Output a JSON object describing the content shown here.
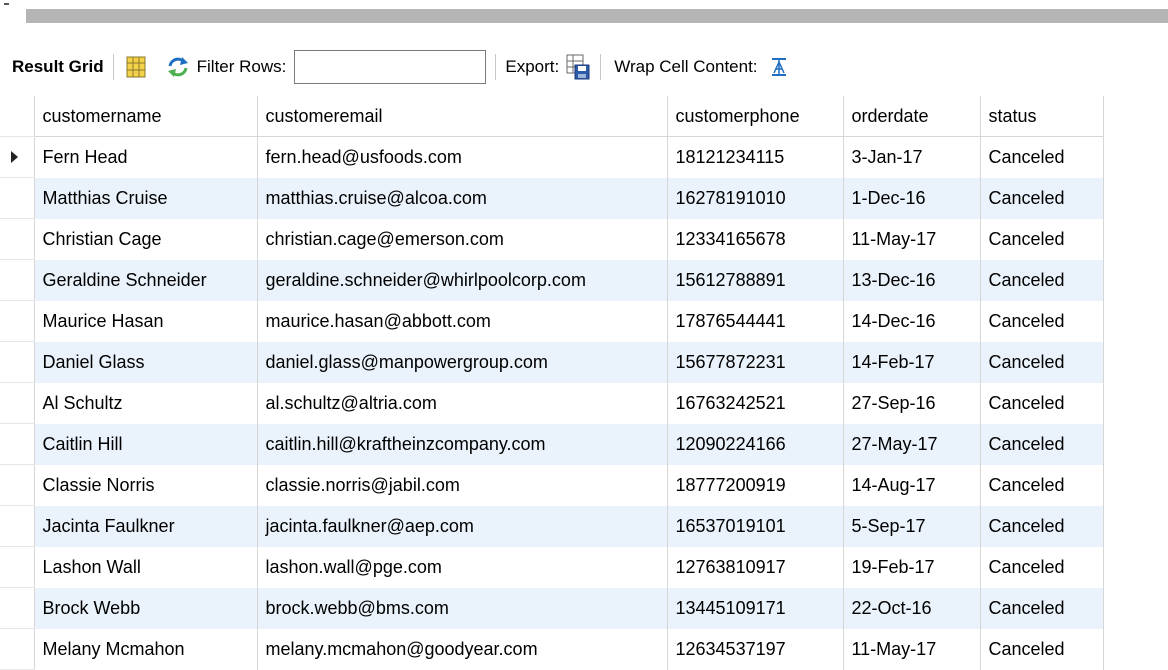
{
  "toolbar": {
    "title": "Result Grid",
    "filter_label": "Filter Rows:",
    "filter_value": "",
    "export_label": "Export:",
    "wrap_label": "Wrap Cell Content:",
    "icons": [
      "grid-toggle-icon",
      "refresh-icon",
      "export-icon",
      "wrap-cell-icon"
    ]
  },
  "grid": {
    "columns": [
      "customername",
      "customeremail",
      "customerphone",
      "orderdate",
      "status"
    ],
    "rows": [
      [
        "Fern Head",
        "fern.head@usfoods.com",
        "18121234115",
        "3-Jan-17",
        "Canceled"
      ],
      [
        "Matthias Cruise",
        "matthias.cruise@alcoa.com",
        "16278191010",
        "1-Dec-16",
        "Canceled"
      ],
      [
        "Christian Cage",
        "christian.cage@emerson.com",
        "12334165678",
        "11-May-17",
        "Canceled"
      ],
      [
        "Geraldine Schneider",
        "geraldine.schneider@whirlpoolcorp.com",
        "15612788891",
        "13-Dec-16",
        "Canceled"
      ],
      [
        "Maurice Hasan",
        "maurice.hasan@abbott.com",
        "17876544441",
        "14-Dec-16",
        "Canceled"
      ],
      [
        "Daniel Glass",
        "daniel.glass@manpowergroup.com",
        "15677872231",
        "14-Feb-17",
        "Canceled"
      ],
      [
        "Al Schultz",
        "al.schultz@altria.com",
        "16763242521",
        "27-Sep-16",
        "Canceled"
      ],
      [
        "Caitlin Hill",
        "caitlin.hill@kraftheinzcompany.com",
        "12090224166",
        "27-May-17",
        "Canceled"
      ],
      [
        "Classie Norris",
        "classie.norris@jabil.com",
        "18777200919",
        "14-Aug-17",
        "Canceled"
      ],
      [
        "Jacinta Faulkner",
        "jacinta.faulkner@aep.com",
        "16537019101",
        "5-Sep-17",
        "Canceled"
      ],
      [
        "Lashon Wall",
        "lashon.wall@pge.com",
        "12763810917",
        "19-Feb-17",
        "Canceled"
      ],
      [
        "Brock Webb",
        "brock.webb@bms.com",
        "13445109171",
        "22-Oct-16",
        "Canceled"
      ],
      [
        "Melany Mcmahon",
        "melany.mcmahon@goodyear.com",
        "12634537197",
        "11-May-17",
        "Canceled"
      ]
    ],
    "selected_row": 0
  },
  "colors": {
    "alt_row": "#eaf2fb",
    "grid_line": "#d6d6d6",
    "accent": "#1e6fc2"
  }
}
